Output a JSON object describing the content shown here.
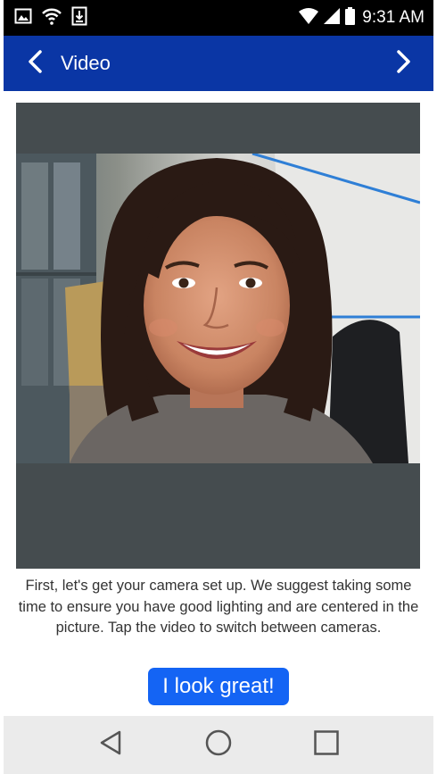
{
  "status_bar": {
    "time": "9:31 AM",
    "icons": [
      "image-icon",
      "wifi-icon",
      "download-icon",
      "wifi-signal-icon",
      "cell-signal-icon",
      "battery-icon"
    ]
  },
  "app_bar": {
    "title": "Video",
    "background": "#0a36a5",
    "back_icon": "chevron-left-icon",
    "forward_icon": "chevron-right-icon"
  },
  "video": {
    "subject": "camera-preview"
  },
  "instructions": {
    "text": "First, let's get your camera set up. We suggest taking some time to ensure you have good lighting and are centered in the picture. Tap the video to switch between cameras."
  },
  "cta": {
    "label": "I look great!",
    "color": "#1464f4"
  },
  "nav_bar": {
    "back_icon": "triangle-back-icon",
    "home_icon": "circle-home-icon",
    "recents_icon": "square-recents-icon"
  }
}
